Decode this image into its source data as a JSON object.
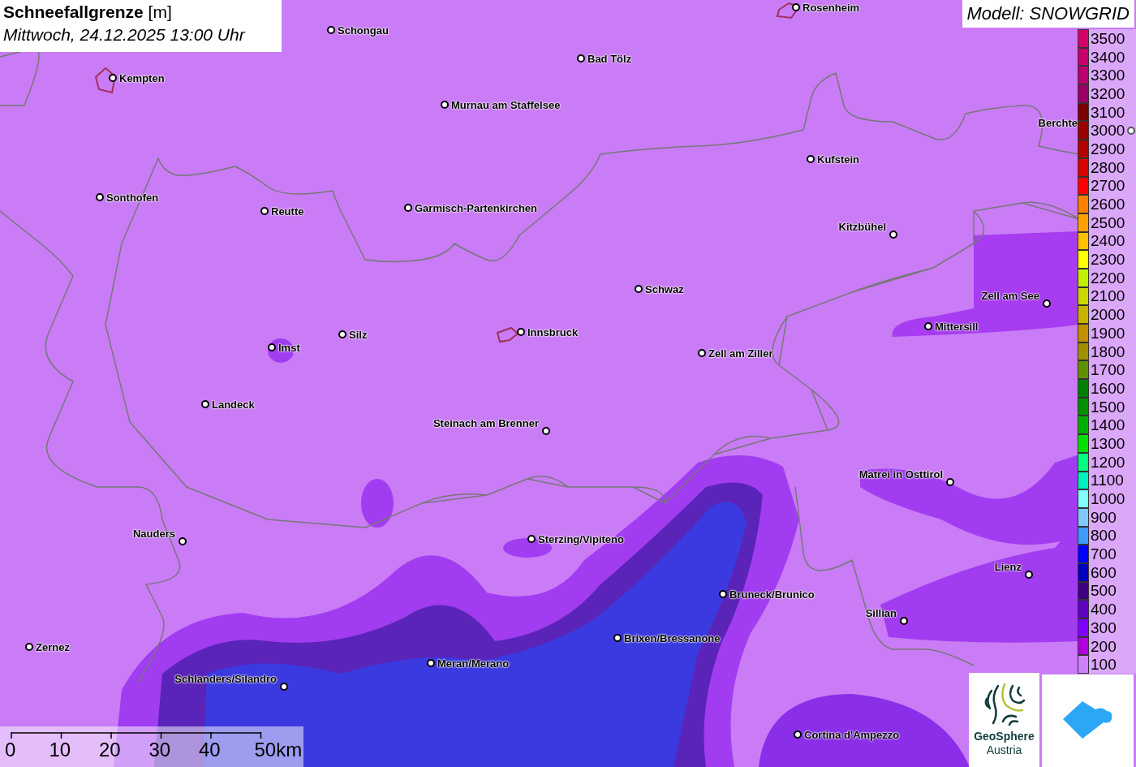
{
  "title": {
    "heading": "**Schneefallgrenze** [m]",
    "subtitle": "Mittwoch, 24.12.2025 13:00 Uhr"
  },
  "model": "Modell: SNOWGRID",
  "places": [
    {
      "name": "Rosenheim"
    },
    {
      "name": "Schongau"
    },
    {
      "name": "Bad Tölz"
    },
    {
      "name": "Kempten"
    },
    {
      "name": "Murnau am Staffelsee"
    },
    {
      "name": "Berchte"
    },
    {
      "name": "Kufstein"
    },
    {
      "name": "Sonthofen"
    },
    {
      "name": "Reutte"
    },
    {
      "name": "Garmisch-Partenkirchen"
    },
    {
      "name": "Kitzbühel"
    },
    {
      "name": "Schwaz"
    },
    {
      "name": "Zell am See"
    },
    {
      "name": "Mittersill"
    },
    {
      "name": "Innsbruck"
    },
    {
      "name": "Silz"
    },
    {
      "name": "Imst"
    },
    {
      "name": "Zell am Ziller"
    },
    {
      "name": "Landeck"
    },
    {
      "name": "Steinach am Brenner"
    },
    {
      "name": "Matrei in Osttirol"
    },
    {
      "name": "Nauders"
    },
    {
      "name": "Sterzing/Vipiteno"
    },
    {
      "name": "Lienz"
    },
    {
      "name": "Bruneck/Brunico"
    },
    {
      "name": "Sillian"
    },
    {
      "name": "Brixen/Bressanone"
    },
    {
      "name": "Zernez"
    },
    {
      "name": "Meran/Merano"
    },
    {
      "name": "Schlanders/Silandro"
    },
    {
      "name": "Cortina d'Ampezzo"
    }
  ],
  "legend": [
    {
      "label": "3500",
      "color": "#d4006a"
    },
    {
      "label": "3400",
      "color": "#c8006e"
    },
    {
      "label": "3300",
      "color": "#b80070"
    },
    {
      "label": "3200",
      "color": "#990066"
    },
    {
      "label": "3100",
      "color": "#7a0000"
    },
    {
      "label": "3000",
      "color": "#990000"
    },
    {
      "label": "2900",
      "color": "#b30000"
    },
    {
      "label": "2800",
      "color": "#d90000"
    },
    {
      "label": "2700",
      "color": "#ff0000"
    },
    {
      "label": "2600",
      "color": "#ff8000"
    },
    {
      "label": "2500",
      "color": "#ffa000"
    },
    {
      "label": "2400",
      "color": "#ffc000"
    },
    {
      "label": "2300",
      "color": "#ffff00"
    },
    {
      "label": "2200",
      "color": "#c0f000"
    },
    {
      "label": "2100",
      "color": "#c8d800"
    },
    {
      "label": "2000",
      "color": "#c8b400"
    },
    {
      "label": "1900",
      "color": "#c09000"
    },
    {
      "label": "1800",
      "color": "#a09000"
    },
    {
      "label": "1700",
      "color": "#609000"
    },
    {
      "label": "1600",
      "color": "#008000"
    },
    {
      "label": "1500",
      "color": "#009000"
    },
    {
      "label": "1400",
      "color": "#00b000"
    },
    {
      "label": "1300",
      "color": "#00e000"
    },
    {
      "label": "1200",
      "color": "#00ff80"
    },
    {
      "label": "1100",
      "color": "#00f0c0"
    },
    {
      "label": "1000",
      "color": "#80ffff"
    },
    {
      "label": "900",
      "color": "#80c8ff"
    },
    {
      "label": "800",
      "color": "#3c9cff"
    },
    {
      "label": "700",
      "color": "#0000ff"
    },
    {
      "label": "600",
      "color": "#0000c0"
    },
    {
      "label": "500",
      "color": "#3c0080"
    },
    {
      "label": "400",
      "color": "#6000c0"
    },
    {
      "label": "300",
      "color": "#8000ff"
    },
    {
      "label": "200",
      "color": "#b000e0"
    },
    {
      "label": "100",
      "color": "#d080ff"
    }
  ],
  "scale_bar": [
    "0",
    "10",
    "20",
    "30",
    "40",
    "50km"
  ],
  "logo": {
    "line1": "GeoSphere",
    "line2": "Austria"
  }
}
